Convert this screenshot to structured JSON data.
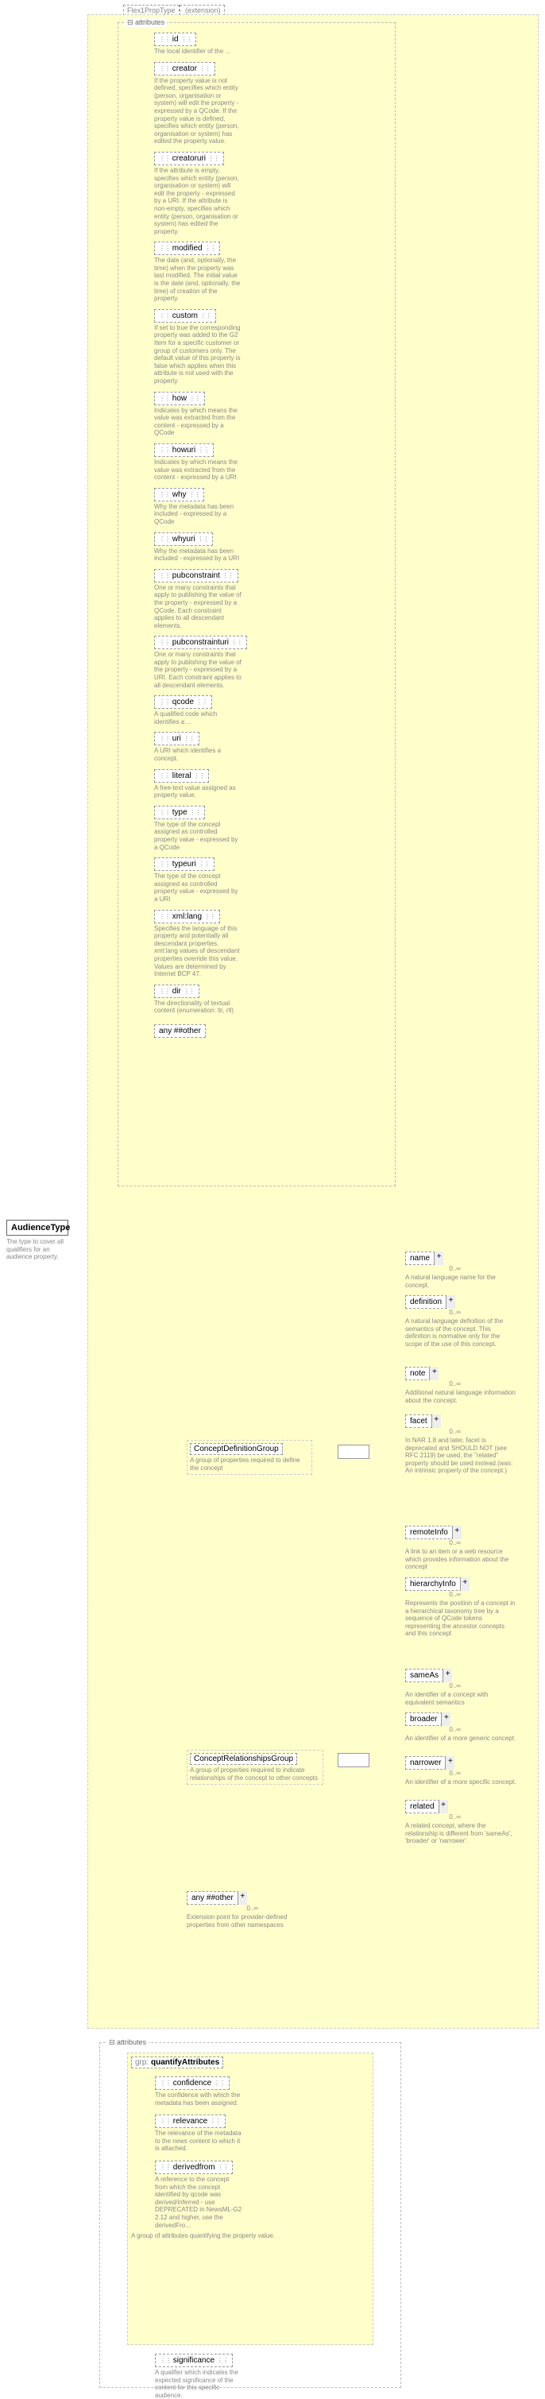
{
  "root": {
    "name": "AudienceType",
    "desc": "The type to cover all qualifiers for an audience property."
  },
  "ext": {
    "label": "Flex1PropType",
    "suffix": " (extension)"
  },
  "attributes_label": "attributes",
  "any_other": "any ##other",
  "attrs1": [
    {
      "n": "id",
      "d": "The local identifier of the ..."
    },
    {
      "n": "creator",
      "d": "If the property value is not defined, specifies which entity (person, organisation or system) will edit the property - expressed by a QCode. If the property value is defined, specifies which entity (person, organisation or system) has edited the property value."
    },
    {
      "n": "creatoruri",
      "d": "If the attribute is empty, specifies which entity (person, organisation or system) will edit the property - expressed by a URI. If the attribute is non-empty, specifies which entity (person, organisation or system) has edited the property."
    },
    {
      "n": "modified",
      "d": "The date (and, optionally, the time) when the property was last modified. The initial value is the date (and, optionally, the time) of creation of the property."
    },
    {
      "n": "custom",
      "d": "If set to true the corresponding property was added to the G2 Item for a specific customer or group of customers only. The default value of this property is false which applies when this attribute is not used with the property."
    },
    {
      "n": "how",
      "d": "Indicates by which means the value was extracted from the content - expressed by a QCode"
    },
    {
      "n": "howuri",
      "d": "Indicates by which means the value was extracted from the content - expressed by a URI"
    },
    {
      "n": "why",
      "d": "Why the metadata has been included - expressed by a QCode"
    },
    {
      "n": "whyuri",
      "d": "Why the metadata has been included - expressed by a URI"
    },
    {
      "n": "pubconstraint",
      "d": "One or many constraints that apply to publishing the value of the property - expressed by a QCode. Each constraint applies to all descendant elements."
    },
    {
      "n": "pubconstrainturi",
      "d": "One or many constraints that apply to publishing the value of the property - expressed by a URI. Each constraint applies to all descendant elements."
    },
    {
      "n": "qcode",
      "d": "A qualified code which identifies a ..."
    },
    {
      "n": "uri",
      "d": "A URI which identifies a concept."
    },
    {
      "n": "literal",
      "d": "A free-text value assigned as property value."
    },
    {
      "n": "type",
      "d": "The type of the concept assigned as controlled property value - expressed by a QCode"
    },
    {
      "n": "typeuri",
      "d": "The type of the concept assigned as controlled property value - expressed by a URI"
    },
    {
      "n": "xml:lang",
      "d": "Specifies the language of this property and potentially all descendant properties. xml:lang values of descendant properties override this value. Values are determined by Internet BCP 47."
    },
    {
      "n": "dir",
      "d": "The directionality of textual content (enumeration: ltr, rtl)"
    }
  ],
  "cdg": {
    "name": "ConceptDefinitionGroup",
    "desc": "A group of properties required to define the concept"
  },
  "crg": {
    "name": "ConceptRelationshipsGroup",
    "desc": "A group of properties required to indicate relationships of the concept to other concepts"
  },
  "cdg_children": [
    {
      "n": "name",
      "d": "A natural language name for the concept."
    },
    {
      "n": "definition",
      "d": "A natural language definition of the semantics of the concept. This definition is normative only for the scope of the use of this concept."
    },
    {
      "n": "note",
      "d": "Additional natural language information about the concept."
    },
    {
      "n": "facet",
      "d": "In NAR 1.8 and later, facet is deprecated and SHOULD NOT (see RFC 2119) be used, the \"related\" property should be used instead.(was: An intrinsic property of the concept.)"
    },
    {
      "n": "remoteInfo",
      "d": "A link to an item or a web resource which provides information about the concept"
    },
    {
      "n": "hierarchyInfo",
      "d": "Represents the position of a concept in a hierarchical taxonomy tree by a sequence of QCode tokens representing the ancestor concepts and this concept"
    }
  ],
  "crg_children": [
    {
      "n": "sameAs",
      "d": "An identifier of a concept with equivalent semantics"
    },
    {
      "n": "broader",
      "d": "An identifier of a more generic concept."
    },
    {
      "n": "narrower",
      "d": "An identifier of a more specific concept."
    },
    {
      "n": "related",
      "d": "A related concept, where the relationship is different from 'sameAs', 'broader' or 'narrower'."
    }
  ],
  "any_ext": {
    "label": "any ##other",
    "desc": "Extension point for provider-defined properties from other namespaces"
  },
  "qa": {
    "prefix": "grp:",
    "name": "quantifyAttributes",
    "desc": "A group of attributes quantifying the property value."
  },
  "qa_attrs": [
    {
      "n": "confidence",
      "d": "The confidence with which the metadata has been assigned."
    },
    {
      "n": "relevance",
      "d": "The relevance of the metadata to the news content to which it is attached."
    },
    {
      "n": "derivedfrom",
      "d": "A reference to the concept from which the concept identified by qcode was derived/inferred - use DEPRECATED in NewsML-G2 2.12 and higher, use the derivedFro..."
    }
  ],
  "sig": {
    "n": "significance",
    "d": "A qualifier which indicates the expected significance of the content for this specific audience."
  },
  "card_inf": "0..∞"
}
